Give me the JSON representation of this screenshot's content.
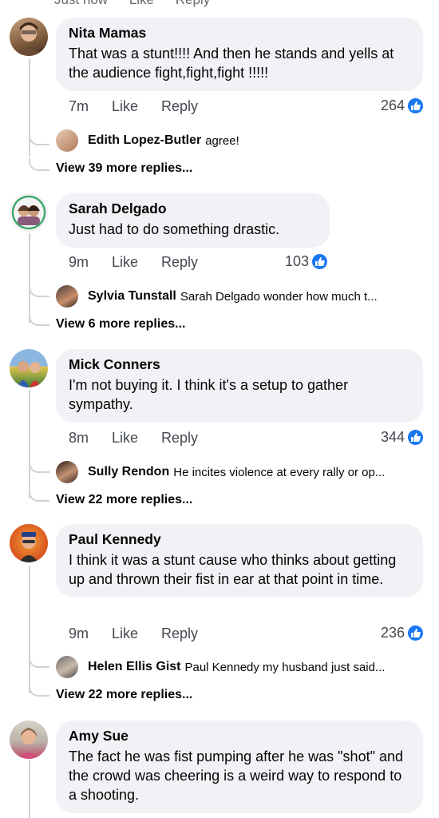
{
  "top_cut": {
    "time": "Just now",
    "like": "Like",
    "reply": "Reply"
  },
  "comments": [
    {
      "author": "Nita Mamas",
      "text": "That was a stunt!!!!  And then he stands and yells at the audience fight,fight,fight !!!!!",
      "time": "7m",
      "like": "Like",
      "reply": "Reply",
      "reactions": "264",
      "reply_preview": {
        "author": "Edith Lopez-Butler",
        "text": "agree!"
      },
      "view_more": "View 39 more replies..."
    },
    {
      "author": "Sarah Delgado",
      "text": "Just had to do something drastic.",
      "time": "9m",
      "like": "Like",
      "reply": "Reply",
      "reactions": "103",
      "reply_preview": {
        "author": "Sylvia Tunstall",
        "text": "Sarah Delgado wonder how much t..."
      },
      "view_more": "View 6 more replies..."
    },
    {
      "author": "Mick Conners",
      "text": "I'm not buying it. I think it's a setup to gather sympathy.",
      "time": "8m",
      "like": "Like",
      "reply": "Reply",
      "reactions": "344",
      "reply_preview": {
        "author": "Sully Rendon",
        "text": "He incites violence at every rally or op..."
      },
      "view_more": "View 22 more replies..."
    },
    {
      "author": "Paul Kennedy",
      "text": "I think it was a stunt cause who thinks about getting up and thrown their fist in ear at that point in time.",
      "time": "9m",
      "like": "Like",
      "reply": "Reply",
      "reactions": "236",
      "reply_preview": {
        "author": "Helen Ellis Gist",
        "text": "Paul Kennedy my husband just said..."
      },
      "view_more": "View 22 more replies..."
    },
    {
      "author": "Amy Sue",
      "text": "The fact he was fist pumping after he was \"shot\" and the crowd was cheering is a weird way to respond to a shooting."
    }
  ]
}
